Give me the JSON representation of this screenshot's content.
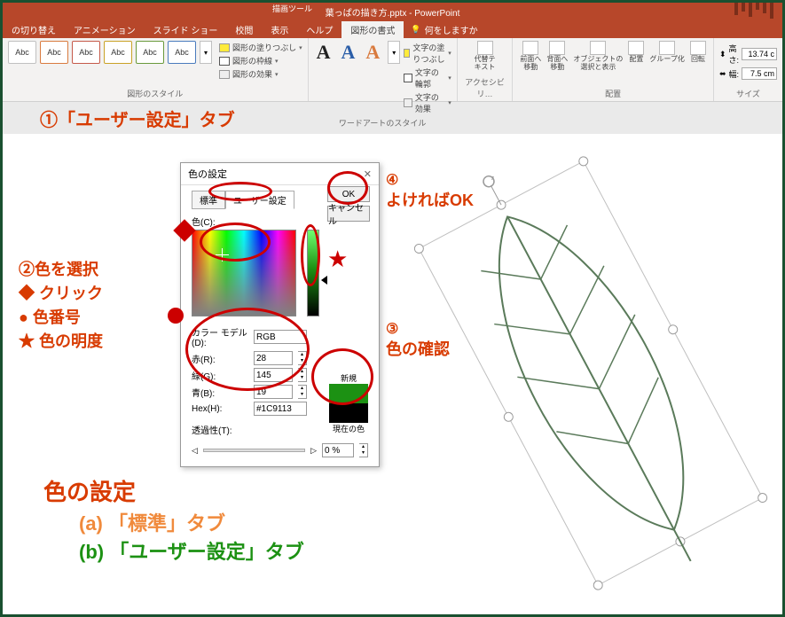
{
  "titlebar": {
    "contextual_tool": "描画ツール",
    "filename": "葉っぱの描き方.pptx - PowerPoint"
  },
  "tabs": {
    "t0": "の切り替え",
    "t1": "アニメーション",
    "t2": "スライド ショー",
    "t3": "校閲",
    "t4": "表示",
    "t5": "ヘルプ",
    "t6": "図形の書式",
    "tell": "何をしますか"
  },
  "ribbon": {
    "style_sample": "Abc",
    "group_styles": "図形のスタイル",
    "fill": "図形の塗りつぶし",
    "outline": "図形の枠線",
    "effects": "図形の効果",
    "group_wordart": "ワードアートのスタイル",
    "text_fill": "文字の塗りつぶし",
    "text_outline": "文字の輪郭",
    "text_effects": "文字の効果",
    "alt_text": "代替テ\nキスト",
    "group_access": "アクセシビリ…",
    "bring_fwd": "前面へ\n移動",
    "send_back": "背面へ\n移動",
    "sel_pane": "オブジェクトの\n選択と表示",
    "align": "配置",
    "group_btn": "グループ化",
    "rotate": "回転",
    "group_arrange": "配置",
    "height_lbl": "高さ:",
    "height_val": "13.74 c",
    "width_lbl": "幅:",
    "width_val": "7.5 cm",
    "group_size": "サイズ"
  },
  "state_band": "①「ユーザー設定」タブ",
  "dialog": {
    "title": "色の設定",
    "tab_std": "標準",
    "tab_custom": "ユーザー設定",
    "ok": "OK",
    "cancel": "キャンセル",
    "color_lbl": "色(C):",
    "model_lbl": "カラー モデル(D):",
    "model_val": "RGB",
    "r_lbl": "赤(R):",
    "r_val": "28",
    "g_lbl": "緑(G):",
    "g_val": "145",
    "b_lbl": "青(B):",
    "b_val": "19",
    "hex_lbl": "Hex(H):",
    "hex_val": "#1C9113",
    "trans_lbl": "透過性(T):",
    "trans_val": "0 %",
    "new_lbl": "新規",
    "cur_lbl": "現在の色"
  },
  "anno": {
    "n2": "②色を選択",
    "n2a": "◆ クリック",
    "n2b": "● 色番号",
    "n2c": "★ 色の明度",
    "n3_num": "③",
    "n3_txt": "色の確認",
    "n4_num": "④",
    "n4_txt": "よければOK",
    "btm_title": "色の設定",
    "btm_a": "(a) 「標準」タブ",
    "btm_b": "(b) 「ユーザー設定」タブ"
  }
}
